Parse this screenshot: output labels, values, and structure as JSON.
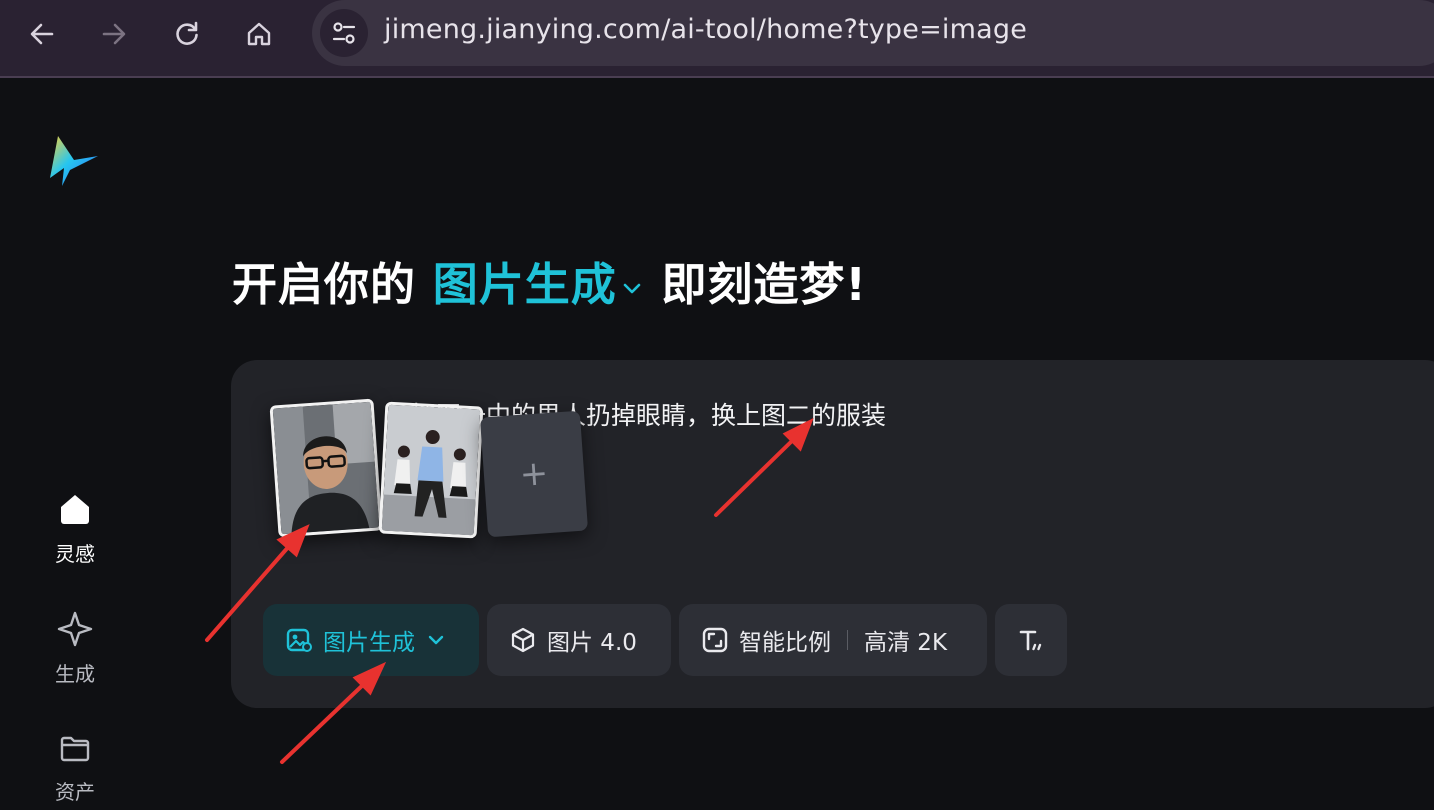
{
  "browser": {
    "url": "jimeng.jianying.com/ai-tool/home?type=image",
    "icons": [
      "back-icon",
      "forward-icon",
      "reload-icon",
      "home-icon",
      "site-settings-icon"
    ]
  },
  "sidebar": {
    "items": [
      {
        "label": "灵感",
        "icon": "home-icon",
        "active": true
      },
      {
        "label": "生成",
        "icon": "sparkle-icon",
        "active": false
      },
      {
        "label": "资产",
        "icon": "folder-icon",
        "active": false
      }
    ]
  },
  "headline": {
    "prefix": "开启你的",
    "mode": "图片生成",
    "suffix": "即刻造梦!"
  },
  "prompt": {
    "text": "把图一中的男人扔掉眼睛，换上图二的服装",
    "add_symbol": "+"
  },
  "toolbar": {
    "mode_label": "图片生成",
    "model_label": "图片 4.0",
    "ratio_label": "智能比例",
    "quality_label": "高清 2K",
    "text_icon": "text-style-icon"
  },
  "colors": {
    "accent": "#1fc2d8",
    "annotation_arrow": "#e8322f",
    "background": "#0f1013",
    "card": "#222328"
  }
}
